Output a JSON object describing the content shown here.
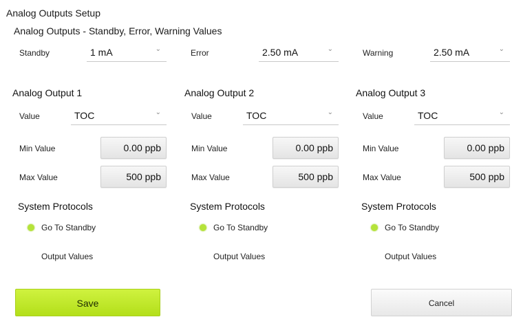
{
  "page_title": "Analog Outputs Setup",
  "fault_values": {
    "title": "Analog Outputs - Standby, Error, Warning Values",
    "standby": {
      "label": "Standby",
      "value": "1 mA"
    },
    "error": {
      "label": "Error",
      "value": "2.50 mA"
    },
    "warning": {
      "label": "Warning",
      "value": "2.50 mA"
    }
  },
  "outputs": [
    {
      "title": "Analog Output 1",
      "value_label": "Value",
      "value": "TOC",
      "min_label": "Min Value",
      "min": "0.00 ppb",
      "max_label": "Max Value",
      "max": "500 ppb",
      "protocols_title": "System Protocols",
      "standby_label": "Go To Standby",
      "output_values_label": "Output Values"
    },
    {
      "title": "Analog Output 2",
      "value_label": "Value",
      "value": "TOC",
      "min_label": "Min Value",
      "min": "0.00 ppb",
      "max_label": "Max Value",
      "max": "500 ppb",
      "protocols_title": "System Protocols",
      "standby_label": "Go To Standby",
      "output_values_label": "Output Values"
    },
    {
      "title": "Analog Output 3",
      "value_label": "Value",
      "value": "TOC",
      "min_label": "Min Value",
      "min": "0.00 ppb",
      "max_label": "Max Value",
      "max": "500 ppb",
      "protocols_title": "System Protocols",
      "standby_label": "Go To Standby",
      "output_values_label": "Output Values"
    }
  ],
  "actions": {
    "save_label": "Save",
    "cancel_label": "Cancel"
  },
  "colors": {
    "accent": "#b8e22a",
    "indicator": "#b5e33a"
  }
}
